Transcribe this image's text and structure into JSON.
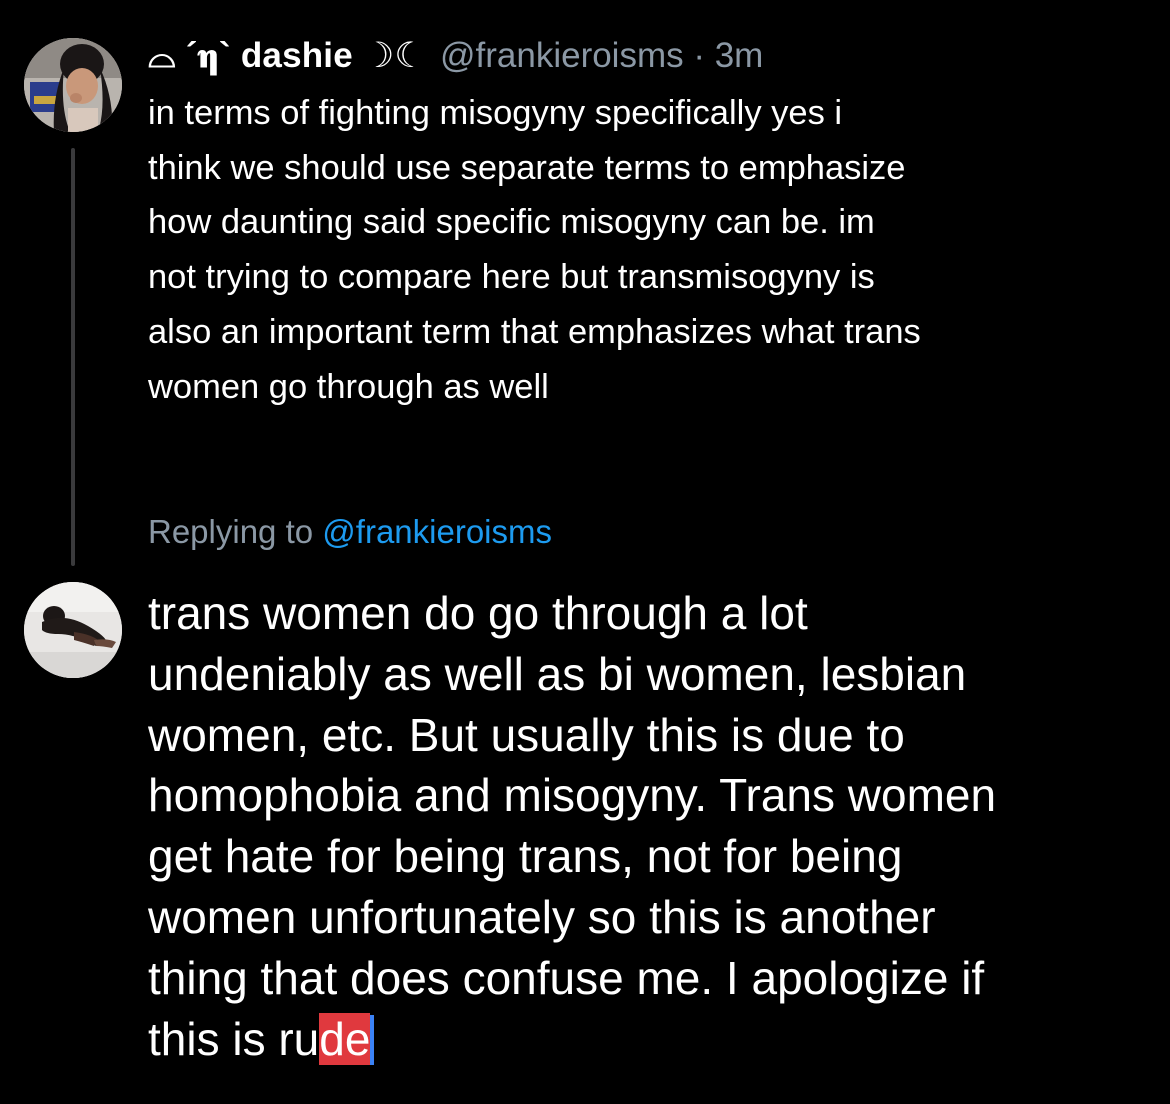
{
  "parent_tweet": {
    "display_name": "⌓ ´𝛈` dashie ☽☾",
    "handle_time": "@frankieroisms · 3m",
    "text": "in terms of fighting misogyny specifically yes i\nthink we should use separate terms to emphasize\nhow daunting said specific misogyny can be. im\nnot trying to compare here but transmisogyny is\nalso an important term that emphasizes what trans\nwomen go through as well"
  },
  "reply_context": {
    "label": "Replying to",
    "mention": "@frankieroisms"
  },
  "compose": {
    "lines": [
      "trans women do go through a lot",
      "undeniably as well as bi women, lesbian",
      "women, etc. But usually this is due to",
      "homophobia and misogyny. Trans women",
      "get hate for being trans, not for being",
      "women unfortunately so this is another",
      "thing that does confuse me. I apologize if"
    ],
    "last_line_prefix": "this is ru",
    "selected_text": "de"
  },
  "colors": {
    "background": "#000000",
    "text": "#ffffff",
    "secondary": "#8b98a5",
    "link": "#1d9bf0",
    "thread_line": "#3a3a3c",
    "selection": "#e0393e",
    "cursor": "#3b82f6"
  },
  "icons": {
    "parent_avatar": "user-avatar-photo",
    "reply_avatar": "user-avatar-photo"
  }
}
